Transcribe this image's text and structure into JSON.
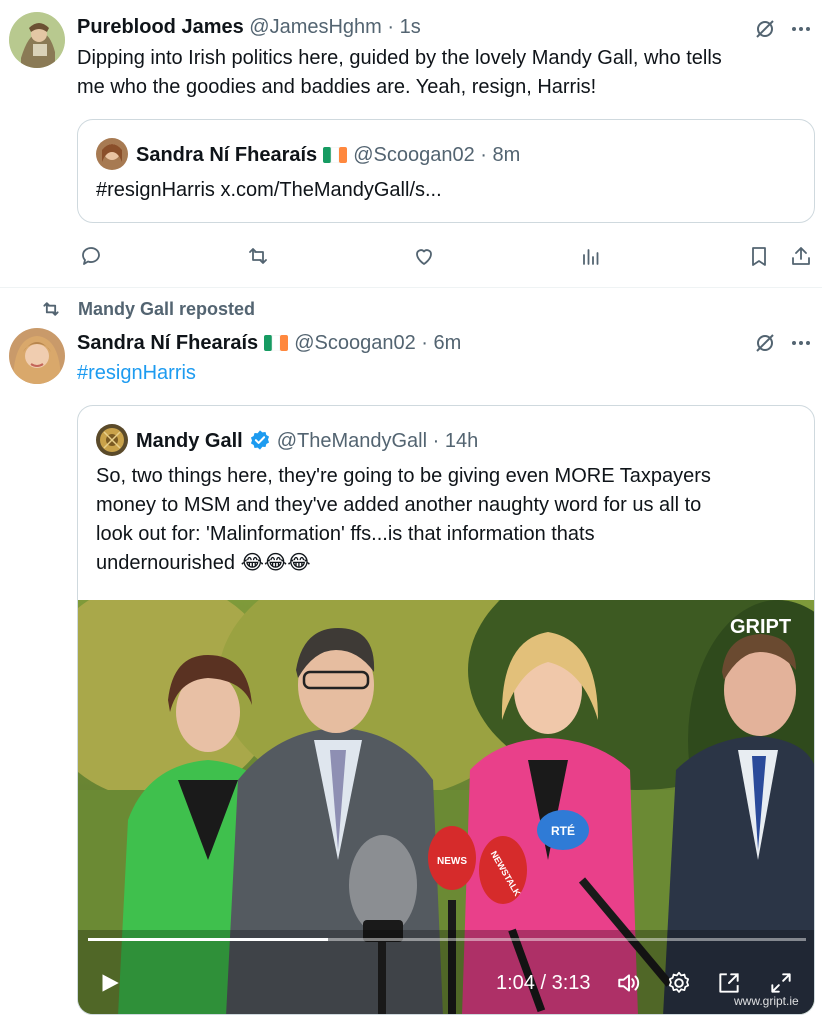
{
  "tweet1": {
    "name": "Pureblood James",
    "handle": "@JamesHghm",
    "separator": "·",
    "time": "1s",
    "text_line1": "Dipping into Irish politics here, guided by the lovely Mandy Gall, who tells",
    "text_line2": "me who the goodies and baddies are. Yeah, resign, Harris!",
    "quote": {
      "name": "Sandra Ní Fhearaís",
      "handle": "@Scoogan02",
      "separator": "·",
      "time": "8m",
      "text": "#resignHarris x.com/TheMandyGall/s..."
    }
  },
  "repost": {
    "label": "Mandy Gall reposted"
  },
  "tweet2": {
    "name": "Sandra Ní Fhearaís",
    "handle": "@Scoogan02",
    "separator": "·",
    "time": "6m",
    "text": "#resignHarris",
    "quote": {
      "name": "Mandy Gall",
      "handle": "@TheMandyGall",
      "separator": "·",
      "time": "14h",
      "text_line1": "So, two things here, they're going to be giving even MORE Taxpayers",
      "text_line2": "money to MSM and they've added another naughty word for us all to",
      "text_line3": "look out for: 'Malinformation' ffs...is that information thats",
      "text_line4": "undernourished",
      "emoji": "😂😂😂",
      "video": {
        "time": "1:04 / 3:13",
        "progress": 0.334,
        "watermark": "GRIPT",
        "watermark_url": "www.gript.ie",
        "mic_labels": [
          "NEWS",
          "NEWSTALK",
          "RTÉ"
        ]
      }
    }
  },
  "colors": {
    "accent": "#1d9bf0",
    "muted": "#536471",
    "text": "#0f1419",
    "border": "#cfd9de",
    "verified": "#1d9bf0",
    "irish_green": "#169b62",
    "irish_orange": "#ff883e"
  },
  "icons": {
    "grok": "grok-icon",
    "more": "more-icon",
    "reply": "reply-icon",
    "retweet": "retweet-icon",
    "like": "like-icon",
    "views": "views-icon",
    "bookmark": "bookmark-icon",
    "share": "share-icon",
    "play": "play-icon",
    "volume": "volume-icon",
    "settings": "settings-icon",
    "pip": "pip-icon",
    "fullscreen": "fullscreen-icon"
  }
}
